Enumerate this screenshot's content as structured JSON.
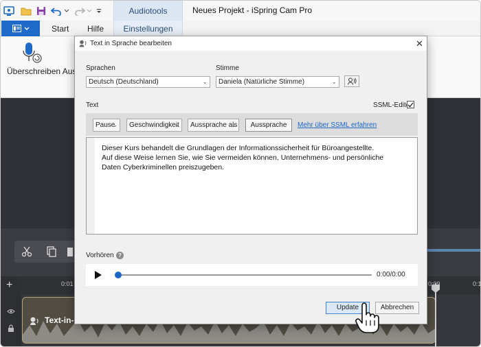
{
  "app": {
    "window_title": "Neues Projekt - iSpring Cam Pro",
    "context_tab": "Audiotools",
    "ribbon_tabs": [
      "Start",
      "Hilfe",
      "Einstellungen"
    ],
    "ribbon_action_label": "Überschreiben Aus"
  },
  "timeline": {
    "ticks": [
      "0:01",
      "0:09",
      "0:1"
    ],
    "clip_label": "Text-in-"
  },
  "dialog": {
    "title": "Text in Sprache bearbeiten",
    "language_label": "Sprachen",
    "language_value": "Deutsch (Deutschland)",
    "voice_label": "Stimme",
    "voice_value": "Daniela (Natürliche Stimme)",
    "text_label": "Text",
    "ssml_editor_label": "SSML-Editor",
    "ssml_editor_checked": true,
    "toolbar": {
      "pause": "Pause",
      "speed": "Geschwindigkeit",
      "pronounce_as": "Aussprache als",
      "pronunciation": "Aussprache",
      "ssml_link": "Mehr über SSML erfahren"
    },
    "text_lines": [
      "Dieser Kurs behandelt die Grundlagen der Informationssicherheit für Büroangestellte.",
      "Auf diese Weise lernen Sie, wie Sie vermeiden können, Unternehmens- und persönliche",
      "Daten Cyberkriminellen preiszugeben."
    ],
    "preview_label": "Vorhören",
    "time_display": "0:00/0:00",
    "update_label": "Update",
    "cancel_label": "Abbrechen"
  },
  "colors": {
    "accent": "#1e6ac8",
    "link": "#1a66c4",
    "stage": "#2f3136",
    "clip_border": "#b9a57a"
  }
}
